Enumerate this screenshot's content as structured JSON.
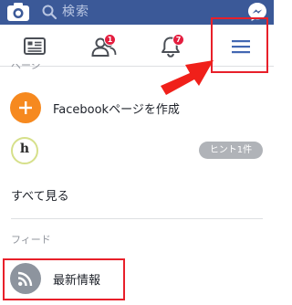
{
  "colors": {
    "brand_blue": "#3b5998",
    "badge_red": "#e41e3f",
    "highlight_red": "#e8202a",
    "create_orange": "#f6891f",
    "muted_gray": "#90949c"
  },
  "topbar": {
    "search_placeholder": "検索",
    "camera_icon": "camera-icon",
    "messenger_icon": "messenger-icon"
  },
  "nav": {
    "tabs": [
      {
        "icon": "news-feed-icon",
        "badge": ""
      },
      {
        "icon": "friend-requests-icon",
        "badge": "1"
      },
      {
        "icon": "notifications-bell-icon",
        "badge": "7"
      },
      {
        "icon": "menu-hamburger-icon",
        "badge": ""
      }
    ]
  },
  "menu": {
    "pages_section_header": "ページ",
    "create_page_label": "Facebookページを作成",
    "hint_logo_letter": "h",
    "hint_badge": "ヒント1件",
    "see_all_label": "すべて見る",
    "feeds_section_header": "フィード",
    "news_feed_label": "最新情報"
  }
}
